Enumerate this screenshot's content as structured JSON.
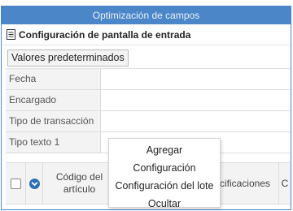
{
  "dialog": {
    "title": "Optimización de campos",
    "subtitle": "Configuración de pantalla de entrada"
  },
  "toolbar": {
    "defaults_label": "Valores predeterminados"
  },
  "form": {
    "rows": [
      {
        "label": "Fecha"
      },
      {
        "label": "Encargado"
      },
      {
        "label": "Tipo de transacción"
      },
      {
        "label": "Tipo texto 1"
      }
    ]
  },
  "grid": {
    "columns": [
      "Código del artículo",
      "Especificaciones",
      "C"
    ]
  },
  "context_menu": {
    "items": [
      "Agregar",
      "Configuración",
      "Configuración del lote",
      "Ocultar"
    ]
  },
  "colors": {
    "title_bar": "#4a86c8",
    "accent_button": "#2f6fb5"
  }
}
